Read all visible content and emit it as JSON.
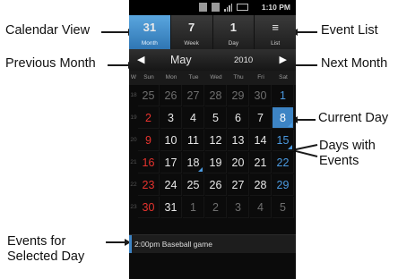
{
  "callouts": {
    "calendar_view": "Calendar View",
    "previous_month": "Previous Month",
    "event_list": "Event List",
    "next_month": "Next Month",
    "current_day": "Current Day",
    "days_with_events_1": "Days with",
    "days_with_events_2": "Events",
    "events_selected_1": "Events for",
    "events_selected_2": "Selected Day"
  },
  "status": {
    "time": "1:10 PM"
  },
  "tabs": [
    {
      "icon": "31",
      "label": "Month"
    },
    {
      "icon": "7",
      "label": "Week"
    },
    {
      "icon": "1",
      "label": "Day"
    },
    {
      "icon": "≡",
      "label": "List"
    }
  ],
  "nav": {
    "prev": "◀",
    "month": "May",
    "year": "2010",
    "next": "▶"
  },
  "dow": {
    "wk": "W",
    "days": [
      "Sun",
      "Mon",
      "Tue",
      "Wed",
      "Thu",
      "Fri",
      "Sat"
    ]
  },
  "weeks": [
    {
      "num": "18",
      "days": [
        "25",
        "26",
        "27",
        "28",
        "29",
        "30",
        "1"
      ]
    },
    {
      "num": "19",
      "days": [
        "2",
        "3",
        "4",
        "5",
        "6",
        "7",
        "8"
      ]
    },
    {
      "num": "20",
      "days": [
        "9",
        "10",
        "11",
        "12",
        "13",
        "14",
        "15"
      ]
    },
    {
      "num": "21",
      "days": [
        "16",
        "17",
        "18",
        "19",
        "20",
        "21",
        "22"
      ]
    },
    {
      "num": "22",
      "days": [
        "23",
        "24",
        "25",
        "26",
        "27",
        "28",
        "29"
      ]
    },
    {
      "num": "23",
      "days": [
        "30",
        "31",
        "1",
        "2",
        "3",
        "4",
        "5"
      ]
    }
  ],
  "event": "2:00pm Baseball game",
  "colors": {
    "accent": "#3d84c4",
    "sunday": "#e8332e",
    "saturday": "#4b9ae0"
  }
}
